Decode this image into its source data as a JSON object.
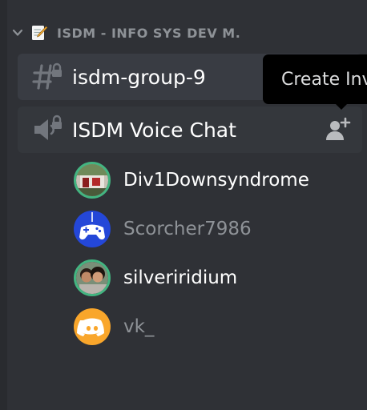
{
  "category": {
    "name": "ISDM - INFO SYS DEV M."
  },
  "channels": [
    {
      "name": "isdm-group-9",
      "type": "text"
    },
    {
      "name": "ISDM Voice Chat",
      "type": "voice"
    }
  ],
  "tooltip": {
    "text": "Create Inv"
  },
  "voice_users": [
    {
      "name": "Div1Downsyndrome",
      "speaking": true
    },
    {
      "name": "Scorcher7986",
      "speaking": false
    },
    {
      "name": "silveriridium",
      "speaking": true
    },
    {
      "name": "vk_",
      "speaking": false
    }
  ],
  "icons": {
    "category_toggle": "chevron-down-icon",
    "category_emoji": "memo-icon",
    "text_channel": "locked-hashtag-icon",
    "voice_channel": "locked-speaker-icon",
    "invite": "add-person-icon"
  },
  "colors": {
    "background": "#2f3136",
    "speaking_ring": "#43b581",
    "tooltip_bg": "#000000",
    "avatar_blue": "#2447d8",
    "avatar_orange": "#f9a62b"
  }
}
